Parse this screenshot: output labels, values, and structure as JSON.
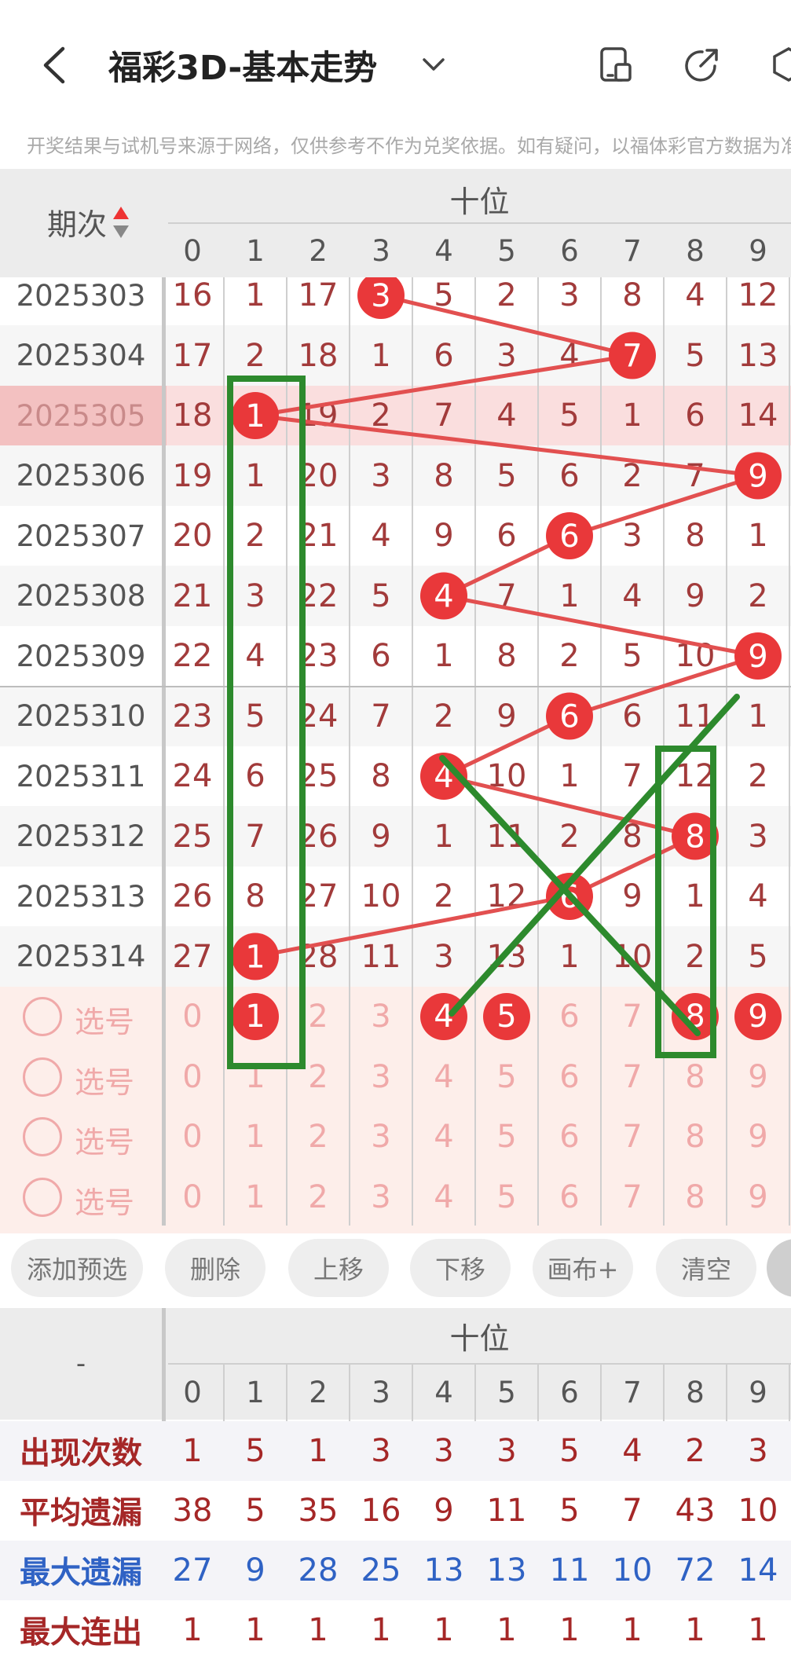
{
  "header": {
    "title": "福彩3D-基本走势",
    "disclaimer": "开奖结果与试机号来源于网络，仅供参考不作为兑奖依据。如有疑问，以福体彩官方数据为准"
  },
  "grid": {
    "period_label": "期次",
    "group_label": "十位",
    "digits": [
      "0",
      "1",
      "2",
      "3",
      "4",
      "5",
      "6",
      "7",
      "8",
      "9"
    ],
    "rows": [
      {
        "issue": "2025303",
        "cells": [
          "16",
          "1",
          "17",
          "3",
          "5",
          "2",
          "3",
          "8",
          "4",
          "12"
        ],
        "hit": 3
      },
      {
        "issue": "2025304",
        "cells": [
          "17",
          "2",
          "18",
          "1",
          "6",
          "3",
          "4",
          "7",
          "5",
          "13"
        ],
        "hit": 7
      },
      {
        "issue": "2025305",
        "cells": [
          "18",
          "1",
          "19",
          "2",
          "7",
          "4",
          "5",
          "1",
          "6",
          "14"
        ],
        "hit": 1
      },
      {
        "issue": "2025306",
        "cells": [
          "19",
          "1",
          "20",
          "3",
          "8",
          "5",
          "6",
          "2",
          "7",
          "9"
        ],
        "hit": 9
      },
      {
        "issue": "2025307",
        "cells": [
          "20",
          "2",
          "21",
          "4",
          "9",
          "6",
          "6",
          "3",
          "8",
          "1"
        ],
        "hit": 6
      },
      {
        "issue": "2025308",
        "cells": [
          "21",
          "3",
          "22",
          "5",
          "4",
          "7",
          "1",
          "4",
          "9",
          "2"
        ],
        "hit": 4
      },
      {
        "issue": "2025309",
        "cells": [
          "22",
          "4",
          "23",
          "6",
          "1",
          "8",
          "2",
          "5",
          "10",
          "9"
        ],
        "hit": 9
      },
      {
        "issue": "2025310",
        "cells": [
          "23",
          "5",
          "24",
          "7",
          "2",
          "9",
          "6",
          "6",
          "11",
          "1"
        ],
        "hit": 6
      },
      {
        "issue": "2025311",
        "cells": [
          "24",
          "6",
          "25",
          "8",
          "4",
          "10",
          "1",
          "7",
          "12",
          "2"
        ],
        "hit": 4
      },
      {
        "issue": "2025312",
        "cells": [
          "25",
          "7",
          "26",
          "9",
          "1",
          "11",
          "2",
          "8",
          "8",
          "3"
        ],
        "hit": 8
      },
      {
        "issue": "2025313",
        "cells": [
          "26",
          "8",
          "27",
          "10",
          "2",
          "12",
          "6",
          "9",
          "1",
          "4"
        ],
        "hit": 6
      },
      {
        "issue": "2025314",
        "cells": [
          "27",
          "1",
          "28",
          "11",
          "3",
          "13",
          "1",
          "10",
          "2",
          "5"
        ],
        "hit": 1
      }
    ],
    "select_label": "选号",
    "select_rows": [
      {
        "cells": [
          "0",
          "1",
          "2",
          "3",
          "4",
          "5",
          "6",
          "7",
          "8",
          "9"
        ],
        "balls": [
          1,
          4,
          5,
          8,
          9
        ]
      },
      {
        "cells": [
          "0",
          "1",
          "2",
          "3",
          "4",
          "5",
          "6",
          "7",
          "8",
          "9"
        ],
        "balls": []
      },
      {
        "cells": [
          "0",
          "1",
          "2",
          "3",
          "4",
          "5",
          "6",
          "7",
          "8",
          "9"
        ],
        "balls": []
      },
      {
        "cells": [
          "0",
          "1",
          "2",
          "3",
          "4",
          "5",
          "6",
          "7",
          "8",
          "9"
        ],
        "balls": []
      }
    ]
  },
  "buttons": [
    "添加预选",
    "删除",
    "上移",
    "下移",
    "画布+",
    "清空"
  ],
  "stats": {
    "corner": "-",
    "group_label": "十位",
    "digits": [
      "0",
      "1",
      "2",
      "3",
      "4",
      "5",
      "6",
      "7",
      "8",
      "9"
    ],
    "rows": [
      {
        "label": "出现次数",
        "color": "#a52727",
        "values": [
          "1",
          "5",
          "1",
          "3",
          "3",
          "3",
          "5",
          "4",
          "2",
          "3"
        ]
      },
      {
        "label": "平均遗漏",
        "color": "#a52727",
        "values": [
          "38",
          "5",
          "35",
          "16",
          "9",
          "11",
          "5",
          "7",
          "43",
          "10"
        ]
      },
      {
        "label": "最大遗漏",
        "color": "#2f62c4",
        "values": [
          "27",
          "9",
          "28",
          "25",
          "13",
          "13",
          "11",
          "10",
          "72",
          "14"
        ]
      },
      {
        "label": "最大连出",
        "color": "#a52727",
        "values": [
          "1",
          "1",
          "1",
          "1",
          "1",
          "1",
          "1",
          "1",
          "1",
          "1"
        ]
      }
    ]
  },
  "colors": {
    "ball": "#e9383a",
    "line": "#e25050",
    "annotation": "#2d8a2d"
  }
}
